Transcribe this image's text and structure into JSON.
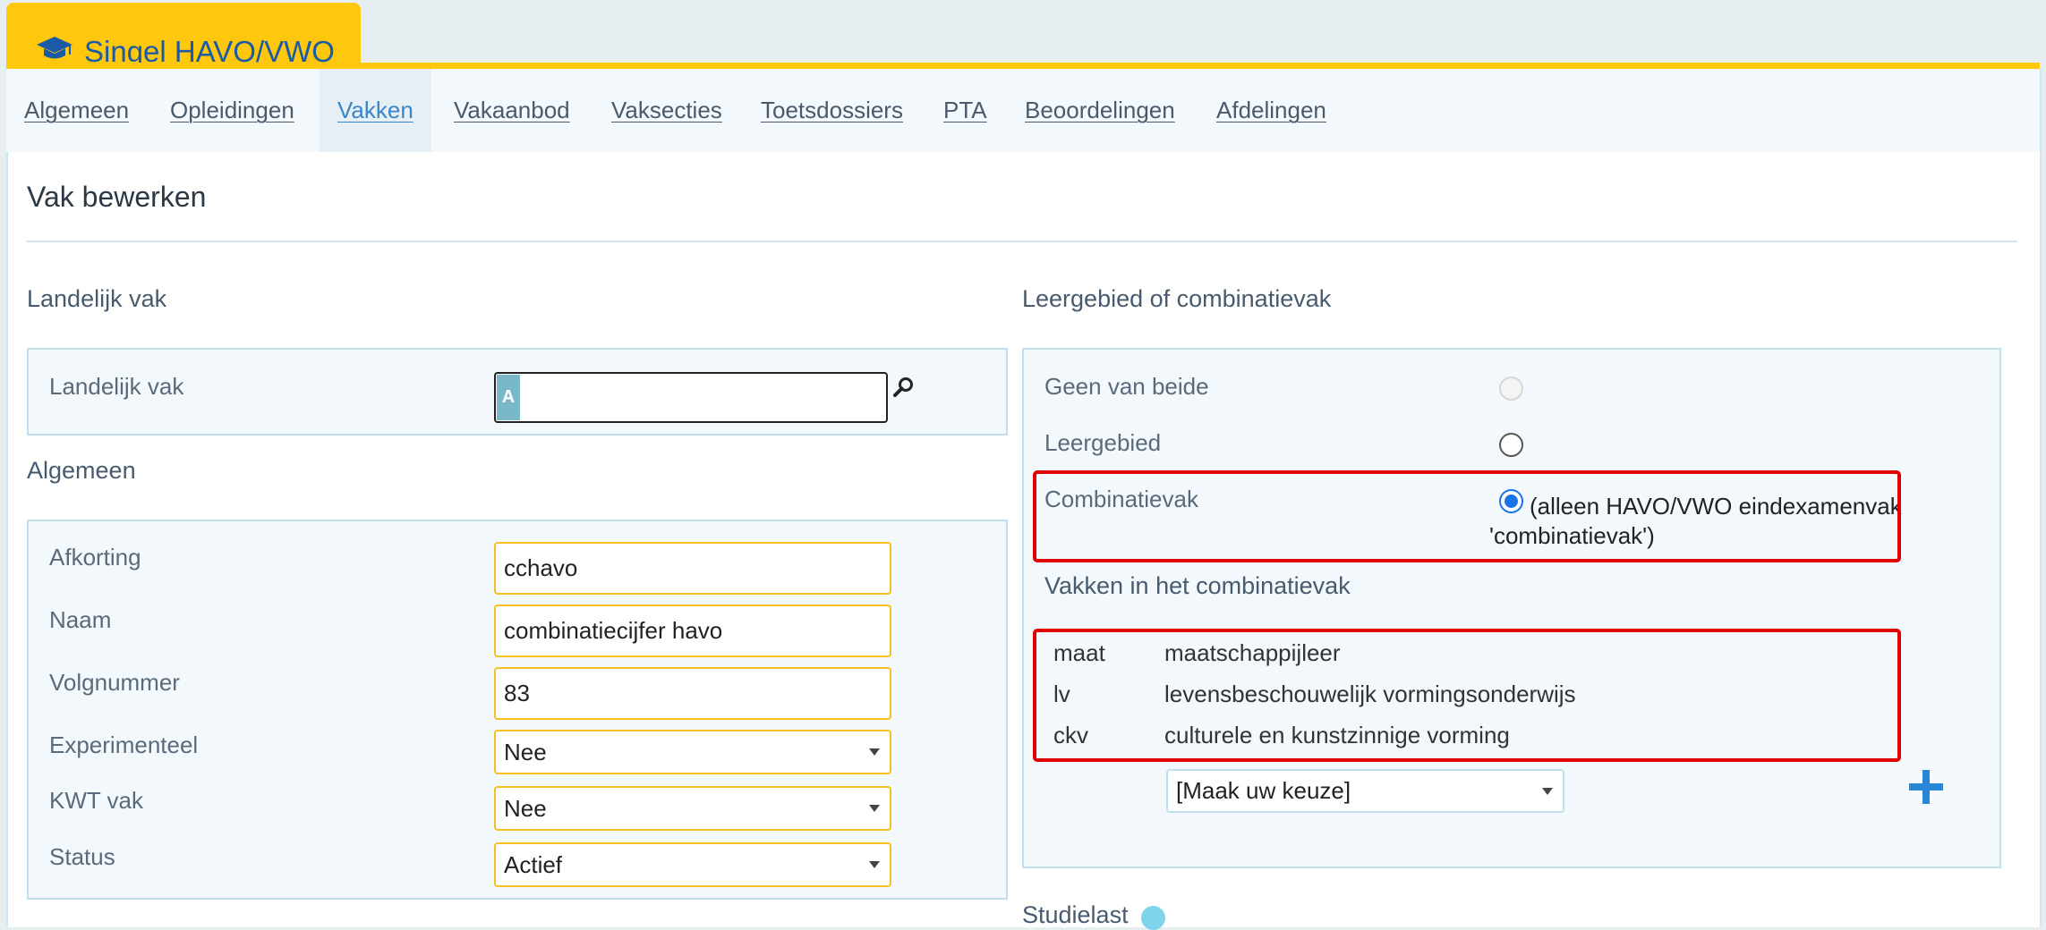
{
  "brand": {
    "title": "Singel HAVO/VWO",
    "icon": "graduation-cap-icon",
    "accent": "#ffc70d",
    "title_color": "#1b5aa7"
  },
  "nav": {
    "tabs": [
      {
        "label": "Algemeen"
      },
      {
        "label": "Opleidingen"
      },
      {
        "label": "Vakken",
        "active": true
      },
      {
        "label": "Vakaanbod"
      },
      {
        "label": "Vaksecties"
      },
      {
        "label": "Toetsdossiers"
      },
      {
        "label": "PTA"
      },
      {
        "label": "Beoordelingen"
      },
      {
        "label": "Afdelingen"
      }
    ]
  },
  "page": {
    "title": "Vak bewerken"
  },
  "landelijk": {
    "heading": "Landelijk vak",
    "field_label": "Landelijk vak",
    "value": "",
    "search_icon": "magnifier-icon"
  },
  "algemeen": {
    "heading": "Algemeen",
    "afkorting": {
      "label": "Afkorting",
      "value": "cchavo"
    },
    "naam": {
      "label": "Naam",
      "value": "combinatiecijfer havo"
    },
    "volgnummer": {
      "label": "Volgnummer",
      "value": "83"
    },
    "experimenteel": {
      "label": "Experimenteel",
      "value": "Nee"
    },
    "kwt": {
      "label": "KWT vak",
      "value": "Nee"
    },
    "status": {
      "label": "Status",
      "value": "Actief"
    }
  },
  "leergebied": {
    "heading": "Leergebied of combinatievak",
    "options": {
      "geen": {
        "label": "Geen van beide",
        "selected": false,
        "disabled": true
      },
      "leergebied": {
        "label": "Leergebied",
        "selected": false
      },
      "combinatievak": {
        "label": "Combinatievak",
        "selected": true,
        "note_line1": "(alleen HAVO/VWO eindexamenvak",
        "note_line2": "'combinatievak')"
      }
    }
  },
  "combinatievak": {
    "heading": "Vakken in het combinatievak",
    "items": [
      {
        "code": "maat",
        "name": "maatschappijleer"
      },
      {
        "code": "lv",
        "name": "levensbeschouwelijk vormingsonderwijs"
      },
      {
        "code": "ckv",
        "name": "culturele en kunstzinnige vorming"
      }
    ],
    "select_value": "[Maak uw keuze]",
    "add_icon": "plus-icon"
  },
  "studielast": {
    "heading": "Studielast",
    "info_icon": "info-icon"
  },
  "colors": {
    "highlight": "#e00000",
    "input_border": "#f5c020",
    "link": "#3a86c8"
  }
}
